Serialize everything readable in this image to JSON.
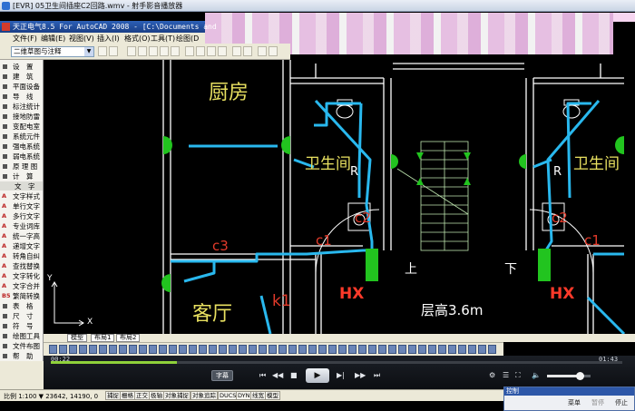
{
  "player": {
    "window_title": "[EVR] 05卫生间插座C2回路.wmv - 射手影音播放器",
    "time_elapsed": "00:22",
    "time_total": "01:43",
    "progress": 0.22,
    "volume": 0.75,
    "subtitle_label": "字幕"
  },
  "cad": {
    "window_title": "天正电气8.5 For AutoCAD 2008 - [C:\\Documents and",
    "menu": [
      "文件(F)",
      "编辑(E)",
      "视图(V)",
      "插入(I)",
      "格式(O)",
      "工具(T)",
      "绘图(D"
    ],
    "combo_value": "二维草图与注释",
    "layout_tabs": [
      "模型",
      "布局1",
      "布局2"
    ],
    "status_coords": "比例 1:100 ▼  23642, 14190, 0",
    "status_toggles": [
      "捕捉",
      "栅格",
      "正交",
      "极轴",
      "对象捕捉",
      "对象追踪",
      "DUCS",
      "DYN",
      "线宽",
      "模型"
    ]
  },
  "sidebar": {
    "items": [
      {
        "label": "设　置",
        "type": "item"
      },
      {
        "label": "建　筑",
        "type": "item"
      },
      {
        "label": "平面设备",
        "type": "item"
      },
      {
        "label": "导　线",
        "type": "item"
      },
      {
        "label": "标注统计",
        "type": "item"
      },
      {
        "label": "接地防雷",
        "type": "item"
      },
      {
        "label": "变配电室",
        "type": "item"
      },
      {
        "label": "系统元件",
        "type": "item"
      },
      {
        "label": "强电系统",
        "type": "item"
      },
      {
        "label": "弱电系统",
        "type": "item"
      },
      {
        "label": "原 理 图",
        "type": "item"
      },
      {
        "label": "计　算",
        "type": "item"
      },
      {
        "label": "文　字",
        "type": "header"
      },
      {
        "label": "文字样式",
        "type": "tool",
        "icon": "A"
      },
      {
        "label": "单行文字",
        "type": "tool",
        "icon": "A"
      },
      {
        "label": "多行文字",
        "type": "tool",
        "icon": "A"
      },
      {
        "label": "专业词库",
        "type": "tool",
        "icon": "A"
      },
      {
        "label": "统一字高",
        "type": "tool",
        "icon": "A"
      },
      {
        "label": "递增文字",
        "type": "tool",
        "icon": "A"
      },
      {
        "label": "转角自纠",
        "type": "tool",
        "icon": "A"
      },
      {
        "label": "查找替换",
        "type": "tool",
        "icon": "A"
      },
      {
        "label": "文字转化",
        "type": "tool",
        "icon": "A"
      },
      {
        "label": "文字合并",
        "type": "tool",
        "icon": "A"
      },
      {
        "label": "繁简转换",
        "type": "tool",
        "icon": "B5"
      },
      {
        "label": "表　格",
        "type": "item"
      },
      {
        "label": "尺　寸",
        "type": "item"
      },
      {
        "label": "符　号",
        "type": "item"
      },
      {
        "label": "绘图工具",
        "type": "item"
      },
      {
        "label": "文件布图",
        "type": "item"
      },
      {
        "label": "帮　助",
        "type": "item"
      }
    ]
  },
  "drawing": {
    "labels": {
      "kitchen": "厨房",
      "living": "客厅",
      "bath_left": "卫生间",
      "bath_right": "卫生间",
      "c3": "c3",
      "c1_left": "c1",
      "c1_right": "c1",
      "c2_left": "c2",
      "c2_right": "c2",
      "k1": "k1",
      "hx_left": "HX",
      "hx_right": "HX",
      "up": "上",
      "down": "下",
      "height": "层高3.6m",
      "ucs_x": "X",
      "ucs_y": "Y",
      "r_left": "R",
      "r_right": "R"
    },
    "colors": {
      "wire": "#29b8ee",
      "wall": "#ffffff",
      "outlet": "#22c41f",
      "text_yellow": "#e8e060",
      "circuit_red": "#e23a2a",
      "hx": "#ff3a2a",
      "stair": "#bfe6b0"
    }
  },
  "control_panel": {
    "title": "控制",
    "menu": "菜单",
    "pause": "暂停",
    "stop": "停止"
  }
}
